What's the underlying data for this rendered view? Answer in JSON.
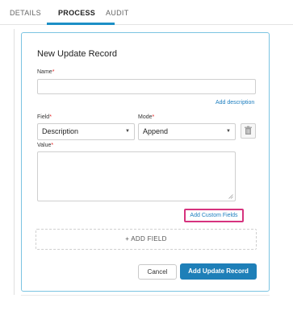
{
  "tabs": [
    {
      "label": "DETAILS",
      "active": false
    },
    {
      "label": "PROCESS",
      "active": true
    },
    {
      "label": "AUDIT",
      "active": false
    }
  ],
  "form": {
    "title": "New Update Record",
    "name_label": "Name",
    "name_value": "",
    "add_description_link": "Add description",
    "field_label": "Field",
    "field_value": "Description",
    "mode_label": "Mode",
    "mode_value": "Append",
    "value_label": "Value",
    "value_text": "",
    "add_custom_fields_link": "Add Custom Fields",
    "add_field_button": "+ ADD FIELD",
    "cancel_button": "Cancel",
    "submit_button": "Add Update Record",
    "required_marker": "*"
  },
  "colors": {
    "accent": "#1e7fb8",
    "tab_underline": "#1c8fc6",
    "card_border": "#7bc4e2",
    "highlight": "#d6337e",
    "required": "#e02020"
  }
}
